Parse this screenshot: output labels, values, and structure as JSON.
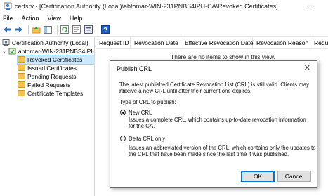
{
  "window": {
    "title": "certsrv - [Certification Authority (Local)\\abtomar-WIN-231PNBS4IPH-CA\\Revoked Certificates]",
    "minimize": "—",
    "close": "✕"
  },
  "menu": [
    "File",
    "Action",
    "View",
    "Help"
  ],
  "tree": {
    "root": "Certification Authority (Local)",
    "ca": "abtomar-WIN-231PNBS4IPH-C",
    "items": [
      "Revoked Certificates",
      "Issued Certificates",
      "Pending Requests",
      "Failed Requests",
      "Certificate Templates"
    ]
  },
  "list": {
    "columns": [
      "Request ID",
      "Revocation Date",
      "Effective Revocation Date",
      "Revocation Reason",
      "Requ"
    ],
    "empty_message": "There are no items to show in this view."
  },
  "dialog": {
    "title": "Publish CRL",
    "close": "✕",
    "description_line1": "The latest published Certificate Revocation List (CRL) is still valid. Clients may not",
    "description_line2": "receive a new CRL until after their current one expires.",
    "type_label": "Type of CRL to publish:",
    "option_new": {
      "label": "New CRL",
      "desc_line1": "Issues a complete CRL, which contains up-to-date revocation information",
      "desc_line2": "for the CA.",
      "selected": true
    },
    "option_delta": {
      "label": "Delta CRL only",
      "desc_line1": "Issues an abbreviated version of the CRL, which contains only the updates to",
      "desc_line2": "the CRL that have been made since the last time it was published.",
      "selected": false
    },
    "ok_label": "OK",
    "cancel_label": "Cancel"
  },
  "colors": {
    "selection": "#cce8ff",
    "folder": "#f2c14e",
    "default_button_border": "#0078d7"
  }
}
